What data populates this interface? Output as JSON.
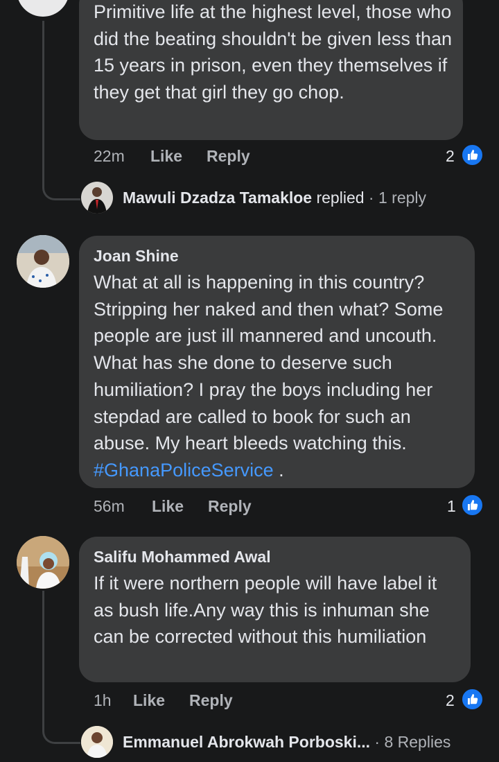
{
  "comments": [
    {
      "author": "",
      "text": "Primitive life at the highest level, those who did the beating shouldn't be given less than 15 years in prison, even they themselves if they get that girl they go chop.",
      "time": "22m",
      "like_label": "Like",
      "reply_label": "Reply",
      "reaction_count": "2",
      "replies": {
        "name": "Mawuli Dzadza Tamakloe",
        "action": "replied",
        "separator": "·",
        "count": "1 reply"
      }
    },
    {
      "author": "Joan Shine",
      "text": "What at all is happening in this country? Stripping her naked and then what? Some people are just ill mannered and uncouth. What has she done to deserve such humiliation? I pray the boys including her stepdad are called to book for such an abuse. My heart bleeds watching this.",
      "hashtag": "#GhanaPoliceService",
      "text_tail": " .",
      "time": "56m",
      "like_label": "Like",
      "reply_label": "Reply",
      "reaction_count": "1"
    },
    {
      "author": "Salifu Mohammed Awal",
      "text": "If it were northern people will have label it as bush life.Any way this is inhuman she can be corrected without this humiliation",
      "time": "1h",
      "like_label": "Like",
      "reply_label": "Reply",
      "reaction_count": "2",
      "replies": {
        "name": "Emmanuel Abrokwah Porboski...",
        "separator": "·",
        "count": "8 Replies"
      }
    }
  ],
  "colors": {
    "background": "#18191a",
    "bubble": "#3a3b3c",
    "text": "#e4e6eb",
    "muted": "#b0b3b8",
    "hashtag": "#4599ff",
    "like_badge": "#1877f2"
  },
  "icons": {
    "reaction": "thumbs-up-icon"
  }
}
